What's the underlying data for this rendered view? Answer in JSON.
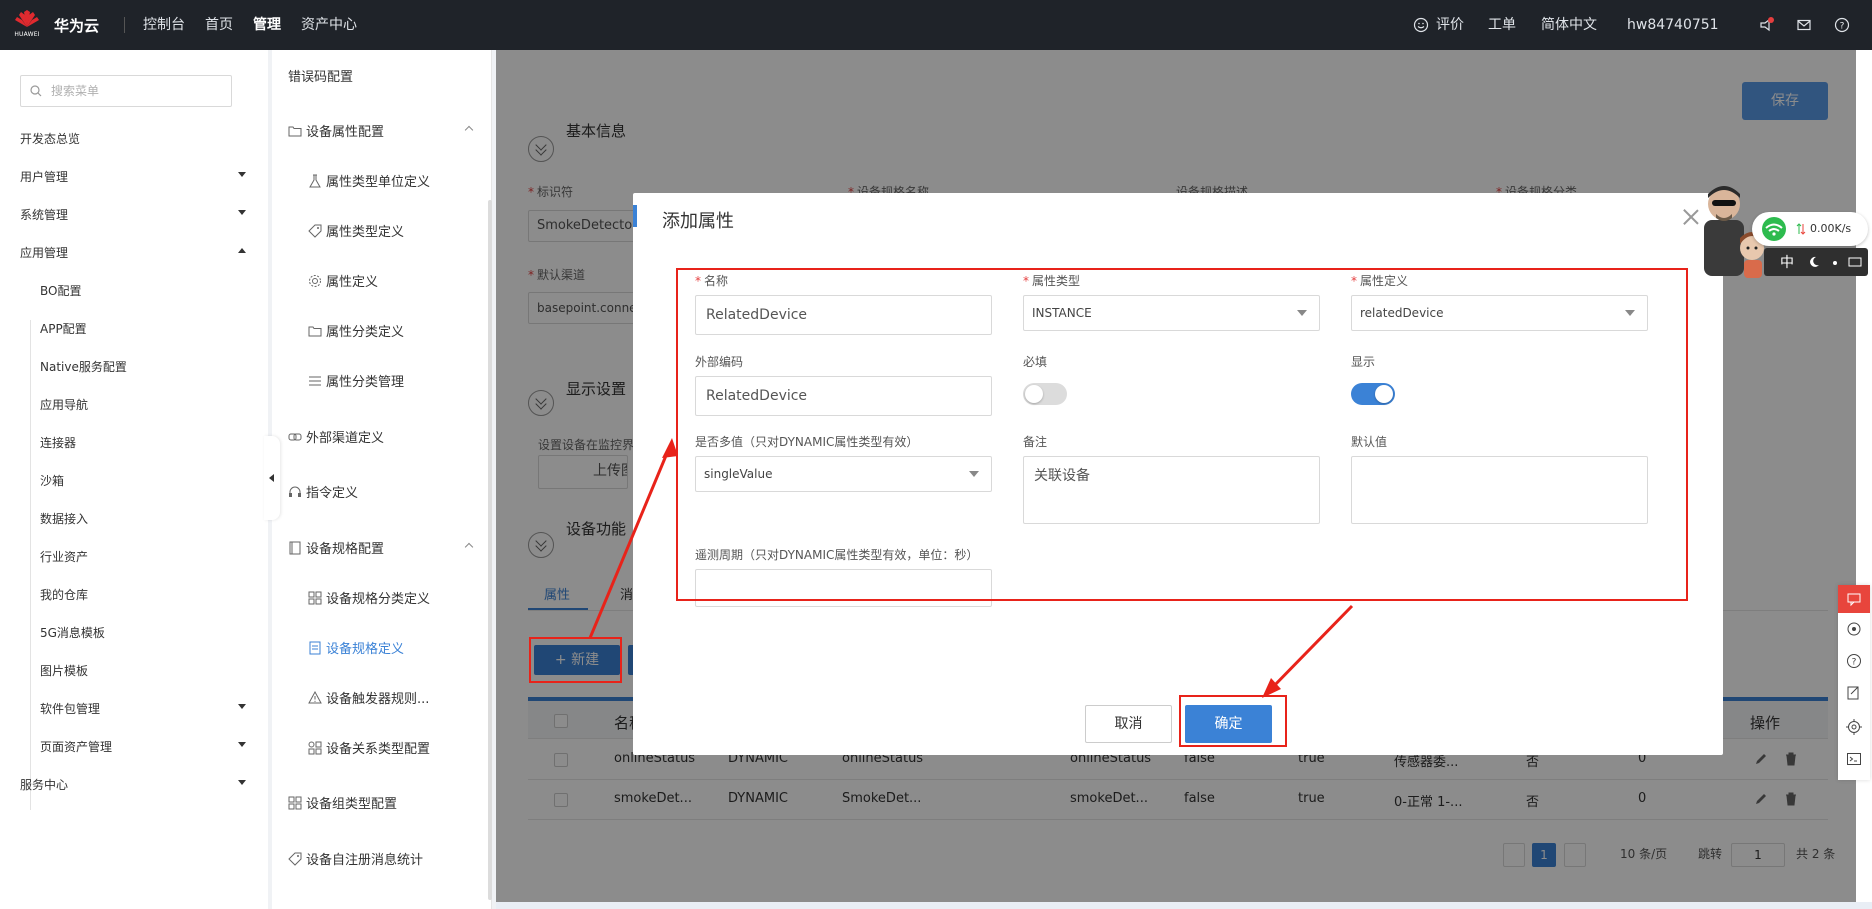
{
  "topbar": {
    "logo_text": "HUAWEI",
    "brand": "华为云",
    "nav": [
      "控制台",
      "首页",
      "管理",
      "资产中心"
    ],
    "active_nav": "管理",
    "feedback": "评价",
    "ticket": "工单",
    "language": "简体中文",
    "user": "hw84740751"
  },
  "sidebar": {
    "search_placeholder": "搜索菜单",
    "items": [
      {
        "label": "开发态总览",
        "arrow": "none"
      },
      {
        "label": "用户管理",
        "arrow": "down"
      },
      {
        "label": "系统管理",
        "arrow": "down"
      },
      {
        "label": "应用管理",
        "arrow": "up"
      }
    ],
    "sub_items": [
      "BO配置",
      "APP配置",
      "Native服务配置",
      "应用导航",
      "连接器",
      "沙箱",
      "数据接入",
      "行业资产",
      "我的仓库",
      "5G消息模板",
      "图片模板",
      "软件包管理",
      "页面资产管理"
    ],
    "service_center": "服务中心"
  },
  "nav2": {
    "items": [
      {
        "label": "错误码配置",
        "level": 0,
        "icon": "none"
      },
      {
        "label": "设备属性配置",
        "level": 0,
        "icon": "folder-icon",
        "expanded": true
      },
      {
        "label": "属性类型单位定义",
        "level": 1,
        "icon": "flask-icon"
      },
      {
        "label": "属性类型定义",
        "level": 1,
        "icon": "tag-icon"
      },
      {
        "label": "属性定义",
        "level": 1,
        "icon": "gear-icon"
      },
      {
        "label": "属性分类定义",
        "level": 1,
        "icon": "folder-icon"
      },
      {
        "label": "属性分类管理",
        "level": 1,
        "icon": "list-icon"
      },
      {
        "label": "外部渠道定义",
        "level": 0,
        "icon": "link-icon"
      },
      {
        "label": "指令定义",
        "level": 0,
        "icon": "headset-icon"
      },
      {
        "label": "设备规格配置",
        "level": 0,
        "icon": "book-icon",
        "expanded": true
      },
      {
        "label": "设备规格分类定义",
        "level": 1,
        "icon": "grid-icon"
      },
      {
        "label": "设备规格定义",
        "level": 1,
        "icon": "doc-icon",
        "active": true
      },
      {
        "label": "设备触发器规则...",
        "level": 1,
        "icon": "warning-icon"
      },
      {
        "label": "设备关系类型配置",
        "level": 1,
        "icon": "grid-icon"
      },
      {
        "label": "设备组类型配置",
        "level": 0,
        "icon": "grid-icon"
      },
      {
        "label": "设备自注册消息统计",
        "level": 0,
        "icon": "tag-icon"
      }
    ]
  },
  "main": {
    "save": "保存",
    "basic_info": "基本信息",
    "identifier_label": "标识符",
    "identifier_value": "SmokeDetector",
    "spec_name_label": "设备规格名称",
    "spec_desc_label": "设备规格描述",
    "spec_category_label": "设备规格分类",
    "default_channel_label": "默认渠道",
    "default_channel_value": "basepoint.connector",
    "display_settings": "显示设置",
    "monitor_label": "设置设备在监控界",
    "upload_label": "上传图",
    "device_function": "设备功能",
    "tab_attributes": "属性",
    "tab_second": "消",
    "new_button": "新建",
    "table": {
      "header_name": "名称",
      "header_action": "操作",
      "rows": [
        [
          "onlineStatus",
          "DYNAMIC",
          "onlineStatus",
          "",
          "onlineStatus",
          "false",
          "true",
          "传感器委...",
          "否",
          "0"
        ],
        [
          "smokeDet...",
          "DYNAMIC",
          "SmokeDet...",
          "",
          "smokeDet...",
          "false",
          "true",
          "0-正常 1-...",
          "否",
          "0"
        ]
      ]
    },
    "pager": {
      "current": "1",
      "page_size": "10 条/页",
      "jump": "跳转",
      "jump_value": "1",
      "total": "共 2 条"
    }
  },
  "dialog": {
    "title": "添加属性",
    "name_label": "名称",
    "name_value": "RelatedDevice",
    "attr_type_label": "属性类型",
    "attr_type_value": "INSTANCE",
    "attr_def_label": "属性定义",
    "attr_def_value": "relatedDevice",
    "external_code_label": "外部编码",
    "external_code_value": "RelatedDevice",
    "required_label": "必填",
    "required_on": false,
    "display_label": "显示",
    "display_on": true,
    "multi_label": "是否多值（只对DYNAMIC属性类型有效）",
    "multi_value": "singleValue",
    "remark_label": "备注",
    "remark_value": "关联设备",
    "default_label": "默认值",
    "default_value": "",
    "telemetry_label": "遥测周期（只对DYNAMIC属性类型有效，单位：秒）",
    "telemetry_value": "",
    "cancel": "取消",
    "confirm": "确定"
  },
  "widget": {
    "net_speed": "0.00K/s",
    "ime": "中"
  },
  "colors": {
    "accent": "#3b82d6",
    "annotation": "#e8231a",
    "topbar": "#1f2329"
  }
}
